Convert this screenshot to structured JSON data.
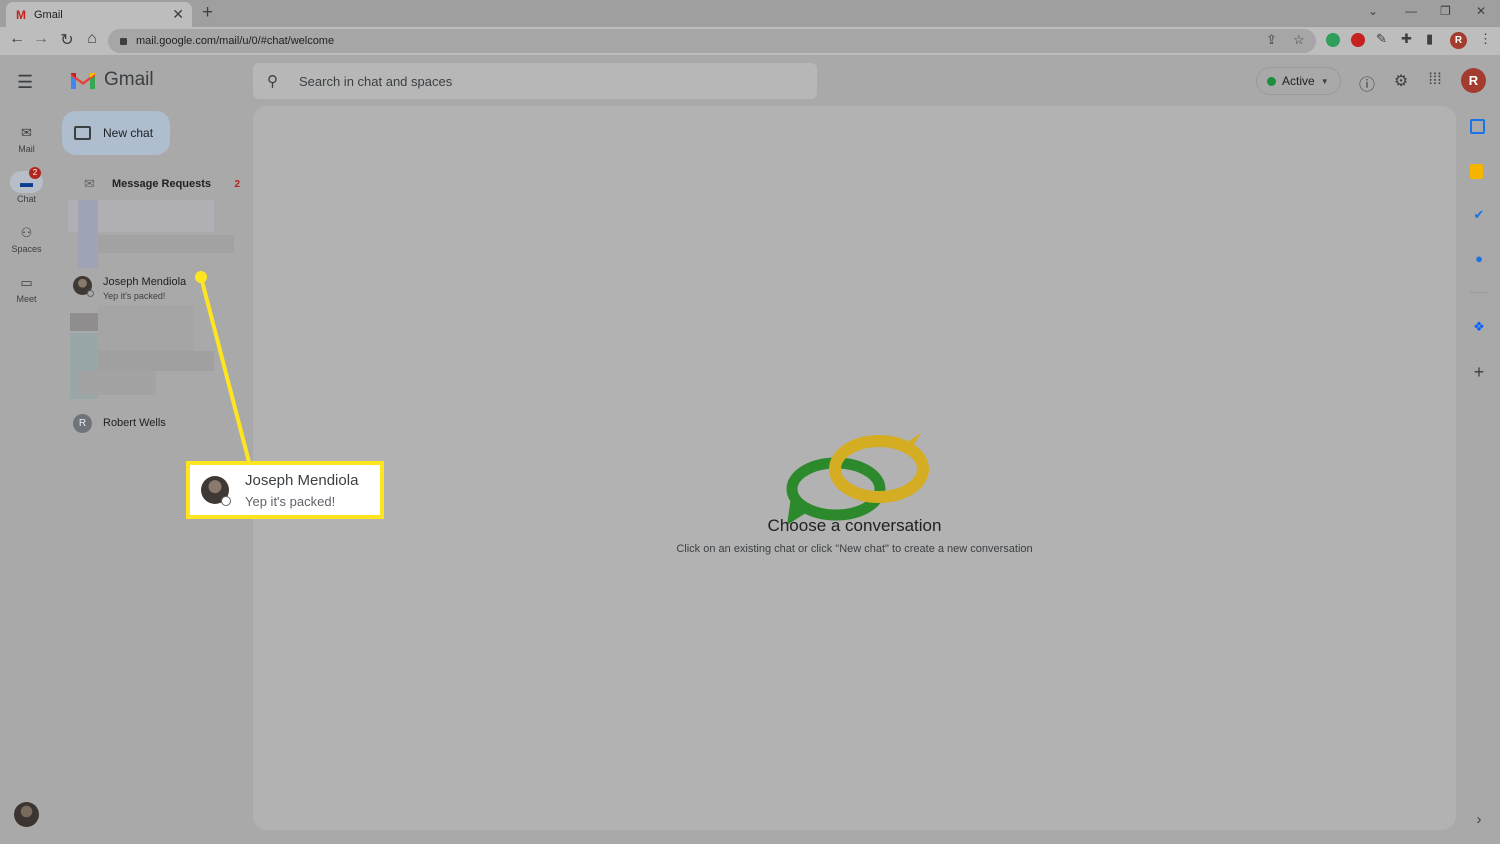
{
  "browser": {
    "tab_title": "Gmail",
    "tab_favicon": "M",
    "new_tab": "+",
    "url": "mail.google.com/mail/u/0/#chat/welcome",
    "profile_initial": "R"
  },
  "header": {
    "app_name": "Gmail",
    "search_placeholder": "Search in chat and spaces",
    "status_label": "Active",
    "account_initial": "R"
  },
  "rail": {
    "items": [
      {
        "label": "Mail",
        "icon": "mail-icon"
      },
      {
        "label": "Chat",
        "icon": "chat-icon",
        "badge": "2",
        "active": true
      },
      {
        "label": "Spaces",
        "icon": "spaces-icon"
      },
      {
        "label": "Meet",
        "icon": "meet-icon"
      }
    ]
  },
  "chat_panel": {
    "new_chat_label": "New chat",
    "message_requests": {
      "label": "Message Requests",
      "count": "2"
    },
    "chats": [
      {
        "name": "Joseph Mendiola",
        "snippet": "Yep it's packed!"
      },
      {
        "name": "Robert Wells",
        "initial": "R"
      }
    ]
  },
  "main": {
    "empty_title": "Choose a conversation",
    "empty_subtitle": "Click on an existing chat or click \"New chat\" to create a new conversation"
  },
  "callout": {
    "name": "Joseph Mendiola",
    "snippet": "Yep it's packed!",
    "highlight_color": "#ffe51f"
  },
  "side_panel": {
    "icons": [
      "calendar-icon",
      "keep-icon",
      "tasks-icon",
      "contacts-icon",
      "dropbox-icon",
      "add-icon",
      "expand-icon"
    ]
  },
  "colors": {
    "accent_red": "#b3261e",
    "status_green": "#1e8e3e",
    "callout_yellow": "#ffe51f"
  }
}
